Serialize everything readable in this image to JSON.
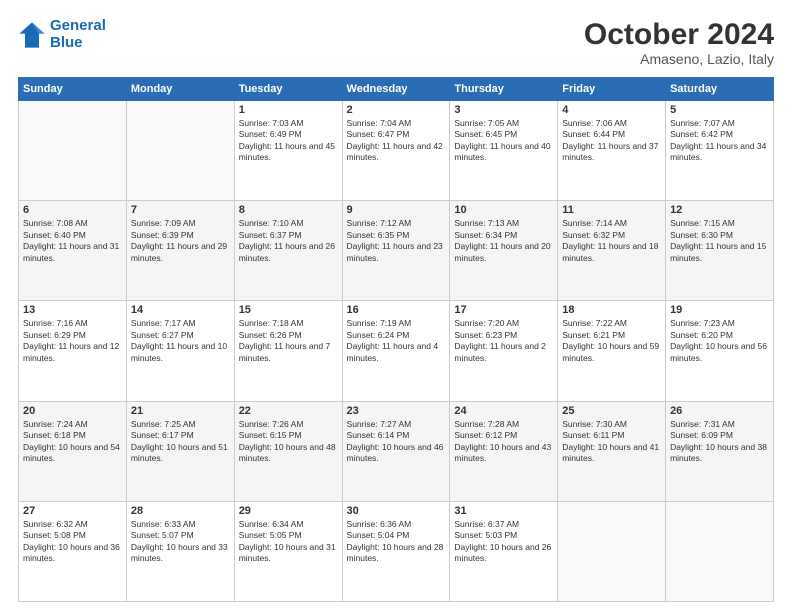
{
  "logo": {
    "line1": "General",
    "line2": "Blue"
  },
  "title": "October 2024",
  "location": "Amaseno, Lazio, Italy",
  "weekdays": [
    "Sunday",
    "Monday",
    "Tuesday",
    "Wednesday",
    "Thursday",
    "Friday",
    "Saturday"
  ],
  "weeks": [
    [
      {
        "day": "",
        "info": ""
      },
      {
        "day": "",
        "info": ""
      },
      {
        "day": "1",
        "info": "Sunrise: 7:03 AM\nSunset: 6:49 PM\nDaylight: 11 hours and 45 minutes."
      },
      {
        "day": "2",
        "info": "Sunrise: 7:04 AM\nSunset: 6:47 PM\nDaylight: 11 hours and 42 minutes."
      },
      {
        "day": "3",
        "info": "Sunrise: 7:05 AM\nSunset: 6:45 PM\nDaylight: 11 hours and 40 minutes."
      },
      {
        "day": "4",
        "info": "Sunrise: 7:06 AM\nSunset: 6:44 PM\nDaylight: 11 hours and 37 minutes."
      },
      {
        "day": "5",
        "info": "Sunrise: 7:07 AM\nSunset: 6:42 PM\nDaylight: 11 hours and 34 minutes."
      }
    ],
    [
      {
        "day": "6",
        "info": "Sunrise: 7:08 AM\nSunset: 6:40 PM\nDaylight: 11 hours and 31 minutes."
      },
      {
        "day": "7",
        "info": "Sunrise: 7:09 AM\nSunset: 6:39 PM\nDaylight: 11 hours and 29 minutes."
      },
      {
        "day": "8",
        "info": "Sunrise: 7:10 AM\nSunset: 6:37 PM\nDaylight: 11 hours and 26 minutes."
      },
      {
        "day": "9",
        "info": "Sunrise: 7:12 AM\nSunset: 6:35 PM\nDaylight: 11 hours and 23 minutes."
      },
      {
        "day": "10",
        "info": "Sunrise: 7:13 AM\nSunset: 6:34 PM\nDaylight: 11 hours and 20 minutes."
      },
      {
        "day": "11",
        "info": "Sunrise: 7:14 AM\nSunset: 6:32 PM\nDaylight: 11 hours and 18 minutes."
      },
      {
        "day": "12",
        "info": "Sunrise: 7:15 AM\nSunset: 6:30 PM\nDaylight: 11 hours and 15 minutes."
      }
    ],
    [
      {
        "day": "13",
        "info": "Sunrise: 7:16 AM\nSunset: 6:29 PM\nDaylight: 11 hours and 12 minutes."
      },
      {
        "day": "14",
        "info": "Sunrise: 7:17 AM\nSunset: 6:27 PM\nDaylight: 11 hours and 10 minutes."
      },
      {
        "day": "15",
        "info": "Sunrise: 7:18 AM\nSunset: 6:26 PM\nDaylight: 11 hours and 7 minutes."
      },
      {
        "day": "16",
        "info": "Sunrise: 7:19 AM\nSunset: 6:24 PM\nDaylight: 11 hours and 4 minutes."
      },
      {
        "day": "17",
        "info": "Sunrise: 7:20 AM\nSunset: 6:23 PM\nDaylight: 11 hours and 2 minutes."
      },
      {
        "day": "18",
        "info": "Sunrise: 7:22 AM\nSunset: 6:21 PM\nDaylight: 10 hours and 59 minutes."
      },
      {
        "day": "19",
        "info": "Sunrise: 7:23 AM\nSunset: 6:20 PM\nDaylight: 10 hours and 56 minutes."
      }
    ],
    [
      {
        "day": "20",
        "info": "Sunrise: 7:24 AM\nSunset: 6:18 PM\nDaylight: 10 hours and 54 minutes."
      },
      {
        "day": "21",
        "info": "Sunrise: 7:25 AM\nSunset: 6:17 PM\nDaylight: 10 hours and 51 minutes."
      },
      {
        "day": "22",
        "info": "Sunrise: 7:26 AM\nSunset: 6:15 PM\nDaylight: 10 hours and 48 minutes."
      },
      {
        "day": "23",
        "info": "Sunrise: 7:27 AM\nSunset: 6:14 PM\nDaylight: 10 hours and 46 minutes."
      },
      {
        "day": "24",
        "info": "Sunrise: 7:28 AM\nSunset: 6:12 PM\nDaylight: 10 hours and 43 minutes."
      },
      {
        "day": "25",
        "info": "Sunrise: 7:30 AM\nSunset: 6:11 PM\nDaylight: 10 hours and 41 minutes."
      },
      {
        "day": "26",
        "info": "Sunrise: 7:31 AM\nSunset: 6:09 PM\nDaylight: 10 hours and 38 minutes."
      }
    ],
    [
      {
        "day": "27",
        "info": "Sunrise: 6:32 AM\nSunset: 5:08 PM\nDaylight: 10 hours and 36 minutes."
      },
      {
        "day": "28",
        "info": "Sunrise: 6:33 AM\nSunset: 5:07 PM\nDaylight: 10 hours and 33 minutes."
      },
      {
        "day": "29",
        "info": "Sunrise: 6:34 AM\nSunset: 5:05 PM\nDaylight: 10 hours and 31 minutes."
      },
      {
        "day": "30",
        "info": "Sunrise: 6:36 AM\nSunset: 5:04 PM\nDaylight: 10 hours and 28 minutes."
      },
      {
        "day": "31",
        "info": "Sunrise: 6:37 AM\nSunset: 5:03 PM\nDaylight: 10 hours and 26 minutes."
      },
      {
        "day": "",
        "info": ""
      },
      {
        "day": "",
        "info": ""
      }
    ]
  ]
}
